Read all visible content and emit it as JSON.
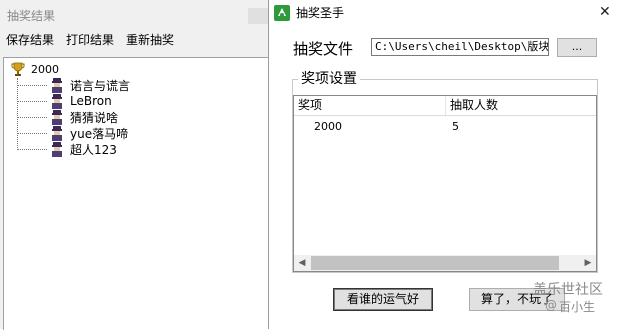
{
  "back_window": {
    "title": "抽奖结果",
    "menu": [
      "保存结果",
      "打印结果",
      "重新抽奖"
    ],
    "tree": {
      "root_label": "2000",
      "root_icon": "trophy-icon",
      "item_icon": "user-avatar-icon",
      "items": [
        "诺言与谎言",
        "LeBron",
        "猜猜说啥",
        "yue落马啼",
        "超人123"
      ]
    }
  },
  "dialog": {
    "title": "抽奖圣手",
    "app_icon": "app-logo-icon",
    "close_glyph": "✕",
    "file_label": "抽奖文件",
    "file_path": "C:\\Users\\cheil\\Desktop\\版块活",
    "browse_label": "...",
    "group_title": "奖项设置",
    "columns": [
      "奖项",
      "抽取人数"
    ],
    "rows": [
      {
        "prize": "2000",
        "count": "5"
      }
    ],
    "buttons": {
      "luck": "看谁的运气好",
      "quit": "算了，不玩了"
    }
  },
  "watermark": {
    "logo": "盖乐世社区",
    "at": "@",
    "user": "百小生"
  },
  "colors": {
    "window_bg": "#f0f0f0",
    "dialog_bg": "#ffffff",
    "button_bg": "#e1e1e1",
    "icon_green": "#2e9b3b"
  }
}
